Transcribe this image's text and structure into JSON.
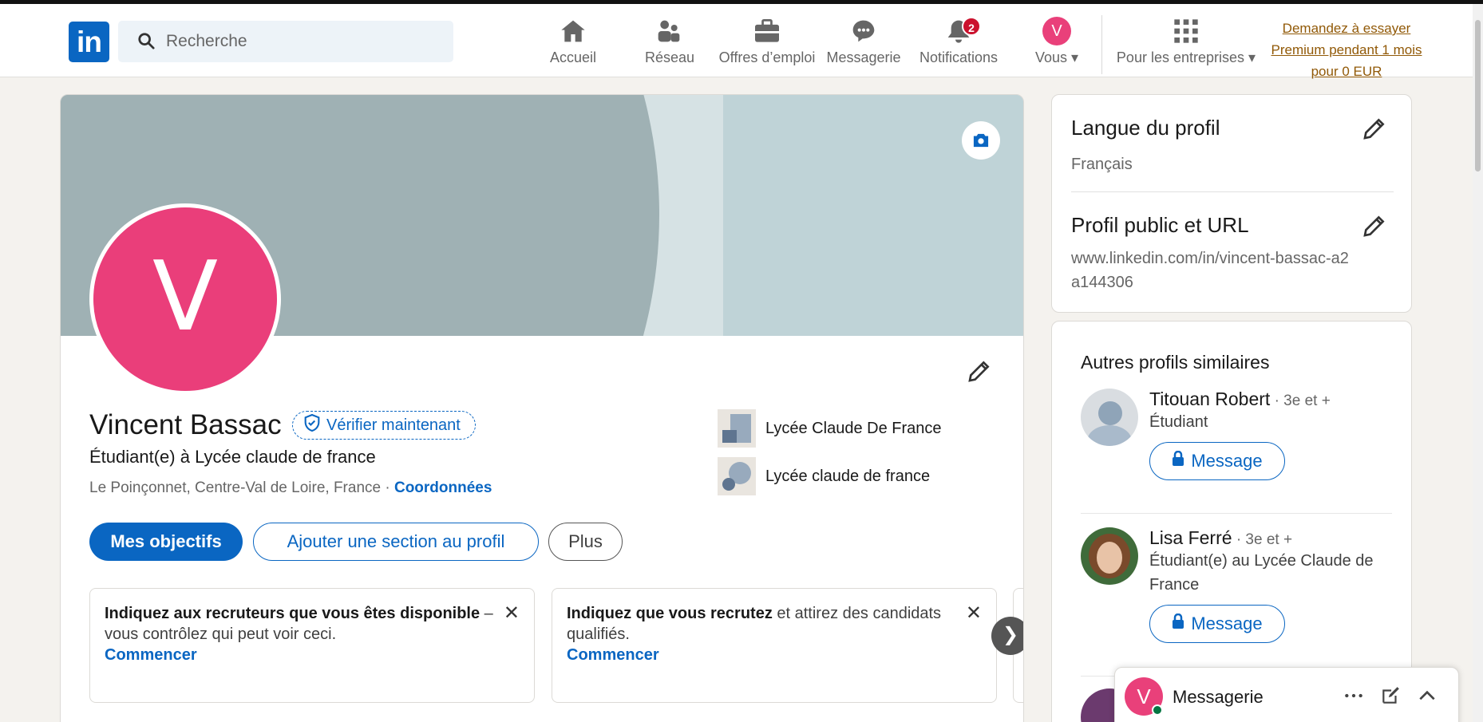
{
  "nav": {
    "logo": "in",
    "search_placeholder": "Recherche",
    "items": [
      {
        "label": "Accueil",
        "icon": "home-icon"
      },
      {
        "label": "Réseau",
        "icon": "network-icon"
      },
      {
        "label": "Offres d’emploi",
        "icon": "briefcase-icon"
      },
      {
        "label": "Messagerie",
        "icon": "messaging-icon"
      },
      {
        "label": "Notifications",
        "icon": "bell-icon",
        "badge": "2"
      },
      {
        "label": "Vous",
        "avatar_letter": "V"
      },
      {
        "label": "Pour les entreprises",
        "icon": "grid-icon"
      }
    ],
    "premium": "Demandez à essayer Premium pendant 1 mois pour 0 EUR"
  },
  "profile": {
    "avatar_letter": "V",
    "name": "Vincent Bassac",
    "verify_label": "Vérifier maintenant",
    "headline": "Étudiant(e) à Lycée claude de france",
    "location": "Le Poinçonnet, Centre-Val de Loire, France · ",
    "contact_link": "Coordonnées",
    "education": [
      "Lycée Claude De France",
      "Lycée claude de france"
    ],
    "buttons": {
      "primary": "Mes objectifs",
      "add_section": "Ajouter une section au profil",
      "more": "Plus"
    }
  },
  "tips": [
    {
      "bold": "Indiquez aux recruteurs que vous êtes disponible",
      "text": " – vous contrôlez qui peut voir ceci.",
      "action": "Commencer"
    },
    {
      "bold": "Indiquez que vous recrutez",
      "text": " et attirez des candidats qualifiés.",
      "action": "Commencer"
    }
  ],
  "sidebar": {
    "lang_title": "Langue du profil",
    "lang_value": "Français",
    "url_title": "Profil public et URL",
    "url_value": "www.linkedin.com/in/vincent-bassac-a2a144306",
    "similar_title": "Autres profils similaires",
    "people": [
      {
        "name": "Titouan Robert",
        "degree": " · 3e et +",
        "desc": "Étudiant",
        "button": "Message"
      },
      {
        "name": "Lisa Ferré",
        "degree": " · 3e et +",
        "desc": "Étudiant(e) au Lycée Claude de France",
        "button": "Message"
      }
    ]
  },
  "messaging": {
    "avatar_letter": "V",
    "title": "Messagerie"
  },
  "colors": {
    "brand": "#0a66c2",
    "avatar": "#e9407a",
    "premium": "#915907"
  }
}
